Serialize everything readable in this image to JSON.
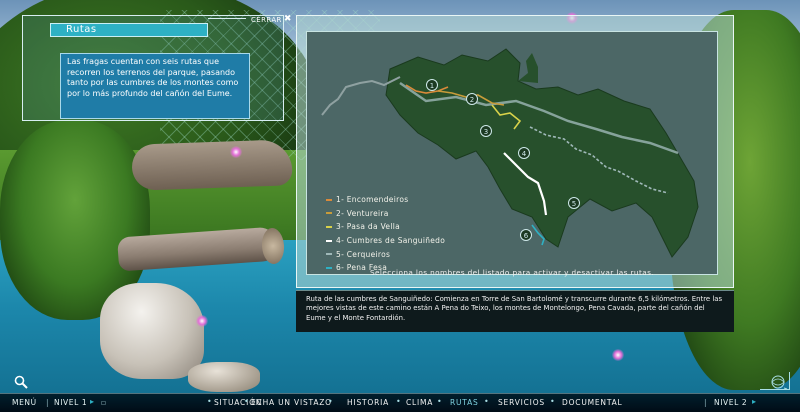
{
  "info": {
    "title": "Rutas",
    "close_label": "CERRAR",
    "text": "Las fragas cuentan con seis rutas que recorren los terrenos del parque, pasando tanto por las cumbres de los montes como por lo más profundo del cañón del Eume."
  },
  "map": {
    "legend": [
      {
        "label": "1- Encomendeiros",
        "color": "#d98a3a"
      },
      {
        "label": "2- Ventureira",
        "color": "#c89c3a"
      },
      {
        "label": "3- Pasa da Vella",
        "color": "#d8d24a"
      },
      {
        "label": "4- Cumbres de Sanguiñedo",
        "color": "#ffffff"
      },
      {
        "label": "5- Cerqueiros",
        "color": "#9fb8b8"
      },
      {
        "label": "6- Pena Fesa",
        "color": "#2eb1c4"
      }
    ],
    "markers": [
      "1",
      "2",
      "3",
      "4",
      "5",
      "6"
    ],
    "hint": "Selecciona los nombres del listado para activar y desactivar las rutas."
  },
  "description": "Ruta de las cumbres de Sanguiñedo: Comienza en Torre de San Bartolomé y transcurre durante 6,5 kilómetros. Entre las mejores vistas de este camino están A Pena do Teixo, los montes de Montelongo, Pena Cavada, parte del cañón del Eume y el Monte Fontardión.",
  "bottom_bar": {
    "menu_label": "MENÚ",
    "level_label": "NIVEL 1",
    "level2_label": "NIVEL 2",
    "nav": [
      "SITUACIÓN",
      "ECHA UN VISTAZO",
      "HISTORIA",
      "CLIMA",
      "RUTAS",
      "SERVICIOS",
      "DOCUMENTAL"
    ],
    "active": "RUTAS"
  },
  "colors": {
    "accent": "#2eb1c4",
    "panel_text_bg": "#1f7ca7",
    "map_land": "#27502c",
    "map_bg": "#4c6766"
  }
}
